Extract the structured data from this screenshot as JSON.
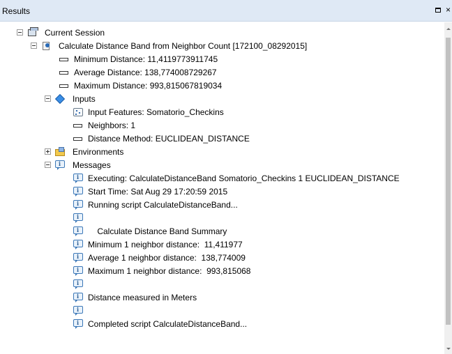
{
  "window": {
    "title": "Results"
  },
  "tree": {
    "session": "Current Session",
    "tool": "Calculate Distance Band from Neighbor Count [172100_08292015]",
    "outputs": [
      "Minimum Distance: 11,4119773911745",
      "Average Distance: 138,774008729267",
      "Maximum Distance: 993,815067819034"
    ],
    "inputs": {
      "label": "Inputs",
      "items": [
        "Input Features: Somatorio_Checkins",
        "Neighbors: 1",
        "Distance Method: EUCLIDEAN_DISTANCE"
      ]
    },
    "environments": "Environments",
    "messages": {
      "label": "Messages",
      "items": [
        "Executing: CalculateDistanceBand Somatorio_Checkins 1 EUCLIDEAN_DISTANCE",
        "Start Time: Sat Aug 29 17:20:59 2015",
        "Running script CalculateDistanceBand...",
        "",
        "    Calculate Distance Band Summary",
        "Minimum 1 neighbor distance:  11,411977",
        "Average 1 neighbor distance:  138,774009",
        "Maximum 1 neighbor distance:  993,815068",
        "",
        "Distance measured in Meters",
        "",
        "Completed script CalculateDistanceBand..."
      ]
    }
  }
}
